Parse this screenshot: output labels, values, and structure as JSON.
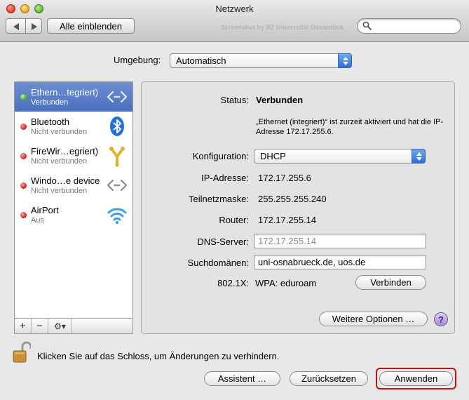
{
  "window": {
    "title": "Netzwerk",
    "watermark": "Screenshot by RZ Universität Osnabrück"
  },
  "toolbar": {
    "show_all_label": "Alle einblenden",
    "search_placeholder": ""
  },
  "environment": {
    "label": "Umgebung:",
    "value": "Automatisch"
  },
  "interfaces": [
    {
      "name": "Ethern…tegriert)",
      "status": "Verbunden",
      "state": "green",
      "selected": true,
      "icon": "ethernet-arrows-icon"
    },
    {
      "name": "Bluetooth",
      "status": "Nicht verbunden",
      "state": "red",
      "selected": false,
      "icon": "bluetooth-icon"
    },
    {
      "name": "FireWir…egriert)",
      "status": "Nicht verbunden",
      "state": "red",
      "selected": false,
      "icon": "firewire-icon"
    },
    {
      "name": "Windo…e device",
      "status": "Nicht verbunden",
      "state": "red",
      "selected": false,
      "icon": "ethernet-arrows-icon"
    },
    {
      "name": "AirPort",
      "status": "Aus",
      "state": "red",
      "selected": false,
      "icon": "airport-wifi-icon"
    }
  ],
  "list_toolbar": {
    "add": "+",
    "remove": "−",
    "action": "⚙▾"
  },
  "detail": {
    "status_label": "Status:",
    "status_value": "Verbunden",
    "status_desc": "„Ethernet (integriert)“ ist zurzeit aktiviert und hat die IP-Adresse 172.17.255.6.",
    "config_label": "Konfiguration:",
    "config_value": "DHCP",
    "ip_label": "IP-Adresse:",
    "ip_value": "172.17.255.6",
    "subnet_label": "Teilnetzmaske:",
    "subnet_value": "255.255.255.240",
    "router_label": "Router:",
    "router_value": "172.17.255.14",
    "dns_label": "DNS-Server:",
    "dns_value": "172.17.255.14",
    "search_domains_label": "Suchdomänen:",
    "search_domains_value": "uni-osnabrueck.de, uos.de",
    "x8021_label": "802.1X:",
    "x8021_value": "WPA: eduroam",
    "connect_label": "Verbinden",
    "more_options_label": "Weitere Optionen …",
    "help_label": "?"
  },
  "footer": {
    "lock_text": "Klicken Sie auf das Schloss, um Änderungen zu verhindern.",
    "assistant_label": "Assistent …",
    "reset_label": "Zurücksetzen",
    "apply_label": "Anwenden"
  },
  "colors": {
    "selection": "#5a7dc8",
    "connected": "#3fa11f",
    "disconnected": "#d21f12",
    "highlight_outline": "#cc1010"
  }
}
